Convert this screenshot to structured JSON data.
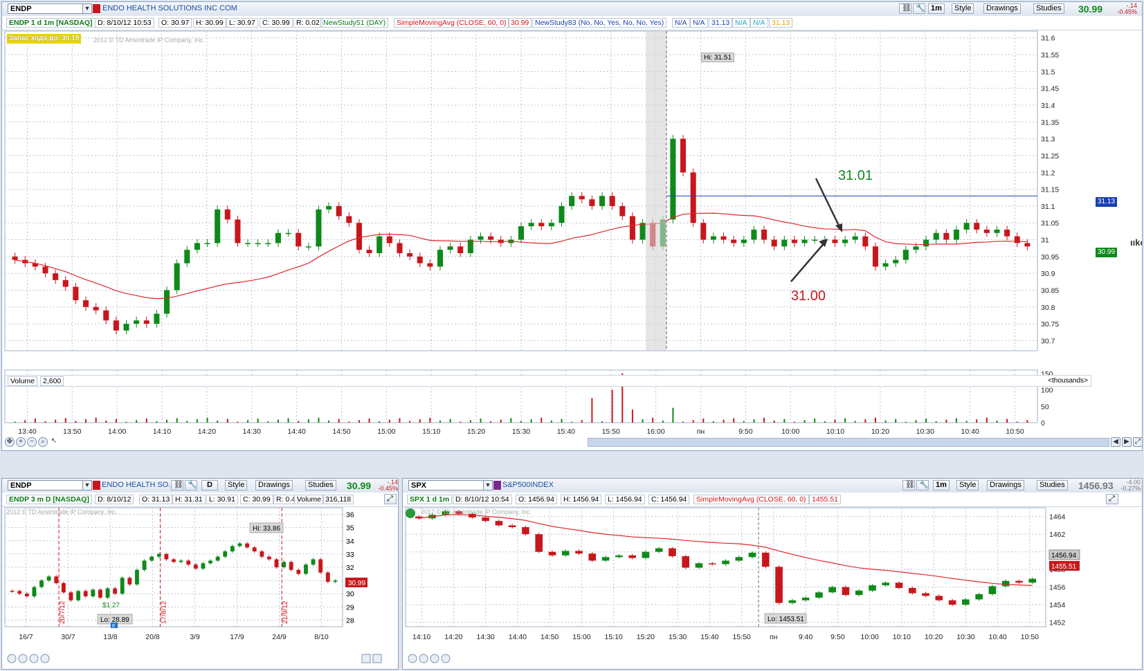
{
  "colors": {
    "up": "#0e8a1a",
    "down": "#c8171c",
    "sma": "#e0262b",
    "grid": "#b8c4d4",
    "accent": "#1a3fb0"
  },
  "main": {
    "symbol": "ENDP",
    "company": "ENDO HEALTH SOLUTIONS INC COM",
    "interval_btn": "1m",
    "style_btn": "Style",
    "drawings_btn": "Drawings",
    "studies_btn": "Studies",
    "last": "30.99",
    "change": "-.14",
    "change_pct": "-0.45%",
    "info": {
      "title": "ENDP 1 d 1m [NASDAQ]",
      "date": "D: 8/10/12 10:53",
      "open": "O: 30.97",
      "high": "H: 30.99",
      "low": "L: 30.97",
      "close": "C: 30.99",
      "range": "R: 0.02",
      "study51": "NewStudy51 (DAY)",
      "sma": "SimpleMovingAvg (CLOSE, 60, 0)",
      "sma_val": "30.99",
      "study83": "NewStudy83 (No, No, Yes, No, No, Yes)",
      "na1": "N/A",
      "na2": "N/A",
      "v1": "31.13",
      "na3": "N/A",
      "na4": "N/A",
      "v2": "31.13"
    },
    "badge": "Запас хода до: 30.19",
    "copyright": "2012 © TD Ameritrade IP Company, Inc.",
    "hi_label": "Hi: 31.51",
    "annot_upper": "31.01",
    "annot_lower": "31.00",
    "right_cut": "ııko",
    "price_tag_blue": "31.13",
    "price_tag_green": "30.99",
    "volume_label": "Volume",
    "volume_value": "2,600",
    "thousands": "<thousands>"
  },
  "chart_data": [
    {
      "type": "candlestick",
      "name": "ENDP 1 d 1m",
      "ylim": [
        30.67,
        31.62
      ],
      "y_ticks": [
        "31.6",
        "31.55",
        "31.5",
        "31.45",
        "31.4",
        "31.35",
        "31.3",
        "31.25",
        "31.2",
        "31.15",
        "31.1",
        "31.05",
        "31",
        "30.95",
        "30.9",
        "30.85",
        "30.8",
        "30.75",
        "30.7"
      ],
      "x_ticks": [
        "13:40",
        "13:50",
        "14:00",
        "14:10",
        "14:20",
        "14:30",
        "14:40",
        "14:50",
        "15:00",
        "15:10",
        "15:20",
        "15:30",
        "15:40",
        "15:50",
        "16:00",
        "пн",
        "9:50",
        "10:00",
        "10:10",
        "10:20",
        "10:30",
        "10:40",
        "10:50"
      ],
      "close": [
        30.94,
        30.93,
        30.92,
        30.9,
        30.88,
        30.86,
        30.82,
        30.8,
        30.79,
        30.76,
        30.73,
        30.75,
        30.76,
        30.75,
        30.78,
        30.85,
        30.93,
        30.97,
        30.99,
        30.99,
        31.09,
        31.06,
        30.99,
        30.99,
        30.99,
        30.99,
        31.02,
        31.02,
        30.98,
        30.98,
        31.09,
        31.1,
        31.07,
        31.05,
        30.97,
        30.96,
        31.01,
        30.99,
        30.96,
        30.95,
        30.93,
        30.92,
        30.97,
        30.98,
        30.96,
        31.0,
        31.01,
        31.0,
        30.99,
        31.0,
        31.04,
        31.05,
        31.04,
        31.05,
        31.1,
        31.13,
        31.12,
        31.1,
        31.13,
        31.1,
        31.07,
        31.0,
        31.05,
        30.98,
        31.06,
        31.3,
        31.2,
        31.05,
        31.0,
        31.01,
        31.0,
        30.99,
        31.0,
        31.03,
        31.0,
        30.98,
        31.0,
        30.99,
        31.0,
        31.0,
        31.0,
        30.99,
        31.0,
        31.01,
        30.98,
        30.92,
        30.93,
        30.94,
        30.97,
        30.98,
        31.0,
        31.02,
        31.0,
        31.03,
        31.05,
        31.03,
        31.02,
        31.03,
        31.01,
        30.99,
        30.98
      ],
      "volume_ylim": [
        0,
        160
      ],
      "volume_ticks": [
        "150",
        "100",
        "50",
        "0"
      ],
      "sma_period": 60
    },
    {
      "type": "candlestick",
      "name": "ENDP 3 m D",
      "ylim": [
        27.5,
        36.5
      ],
      "y_ticks": [
        "36",
        "35",
        "34",
        "33",
        "32",
        "31",
        "30",
        "29",
        "28"
      ],
      "x_ticks": [
        "16/7",
        "30/7",
        "13/8",
        "20/8",
        "3/9",
        "17/9",
        "24/9",
        "8/10"
      ],
      "close": [
        30.2,
        30.0,
        29.8,
        30.5,
        31.0,
        31.3,
        30.8,
        30.1,
        29.5,
        30.2,
        29.8,
        30.3,
        29.7,
        30.4,
        30.0,
        31.2,
        30.7,
        31.8,
        32.5,
        32.8,
        33.0,
        32.6,
        32.4,
        32.5,
        32.2,
        31.9,
        32.3,
        32.5,
        32.8,
        33.2,
        33.6,
        33.8,
        33.5,
        33.2,
        32.8,
        32.6,
        32.0,
        32.4,
        31.8,
        31.5,
        32.2,
        32.6,
        31.6,
        30.9,
        30.99
      ],
      "tag_last": "30.99",
      "hi_label": "Hi: 33.86",
      "lo_label": "Lo: 28.89",
      "vlines": [
        "20/7/12",
        "17/8/12",
        "21/9/12"
      ],
      "marker": "$1.27",
      "marker2": "E"
    },
    {
      "type": "candlestick",
      "name": "SPX 1 d 1m",
      "ylim": [
        1451.5,
        1465
      ],
      "y_ticks": [
        "1464",
        "1462",
        "1460",
        "1458",
        "1456",
        "1454",
        "1452"
      ],
      "x_ticks": [
        "14:10",
        "14:20",
        "14:30",
        "14:40",
        "14:50",
        "15:00",
        "15:10",
        "15:20",
        "15:30",
        "15:40",
        "15:50",
        "пн",
        "9:40",
        "9:50",
        "10:00",
        "10:10",
        "10:20",
        "10:30",
        "10:40",
        "10:50"
      ],
      "close": [
        1463.8,
        1464.2,
        1464.6,
        1464.3,
        1463.9,
        1463.5,
        1463.0,
        1462.8,
        1462.0,
        1460.0,
        1459.6,
        1460.1,
        1459.8,
        1459.0,
        1459.4,
        1459.6,
        1459.3,
        1460.0,
        1460.4,
        1459.5,
        1458.2,
        1458.7,
        1458.6,
        1459.0,
        1459.4,
        1459.9,
        1458.3,
        1454.2,
        1454.5,
        1454.8,
        1455.4,
        1456.0,
        1455.1,
        1455.6,
        1456.2,
        1456.5,
        1455.9,
        1455.3,
        1455.0,
        1454.5,
        1454.0,
        1454.6,
        1455.2,
        1456.1,
        1456.7,
        1456.5,
        1456.94
      ],
      "sma_tag": "1455.51",
      "last_tag": "1456.94",
      "lo_label": "Lo: 1453.51"
    }
  ],
  "left": {
    "symbol": "ENDP",
    "company": "ENDO HEALTH SO...",
    "interval_btn": "D",
    "style_btn": "Style",
    "drawings_btn": "Drawings",
    "studies_btn": "Studies",
    "last": "30.99",
    "change": "-.14",
    "change_pct": "-0.45%",
    "info": {
      "title": "ENDP 3 m D [NASDAQ]",
      "date": "D: 8/10/12",
      "open": "O: 31.13",
      "high": "H: 31.31",
      "low": "L: 30.91",
      "close": "C: 30.99",
      "range": "R: 0.4",
      "volume": "Volume",
      "vol_val": "316,118"
    },
    "copyright": "2012 © TD Ameritrade IP Company, Inc."
  },
  "right": {
    "symbol": "SPX",
    "company": "S&P500INDEX",
    "interval_btn": "1m",
    "style_btn": "Style",
    "drawings_btn": "Drawings",
    "studies_btn": "Studies",
    "last": "1456.93",
    "change": "-4.00",
    "change_pct": "-0.27%",
    "info": {
      "title": "SPX 1 d 1m",
      "date": "D: 8/10/12 10:54",
      "open": "O: 1456.94",
      "high": "H: 1456.94",
      "low": "L: 1456.94",
      "close": "C: 1456.94",
      "sma": "SimpleMovingAvg (CLOSE, 60, 0)",
      "sma_val": "1455.51"
    },
    "copyright": "2012 © TD Ameritrade IP Company, Inc."
  }
}
